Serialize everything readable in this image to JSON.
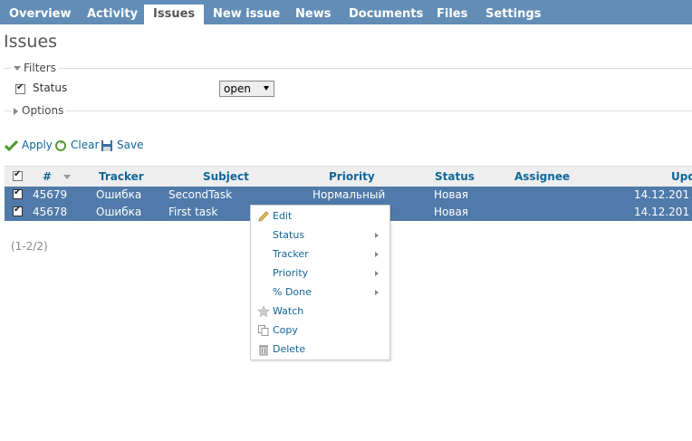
{
  "nav": {
    "tabs": [
      {
        "label": "Overview"
      },
      {
        "label": "Activity"
      },
      {
        "label": "Issues"
      },
      {
        "label": "New issue"
      },
      {
        "label": "News"
      },
      {
        "label": "Documents"
      },
      {
        "label": "Files"
      },
      {
        "label": "Settings"
      }
    ],
    "selected": "Issues"
  },
  "page_title": "Issues",
  "filters": {
    "legend": "Filters",
    "status_label": "Status",
    "status_value": "open",
    "status_checked": true
  },
  "options": {
    "legend": "Options"
  },
  "actions": {
    "apply": "Apply",
    "clear": "Clear",
    "save": "Save"
  },
  "table": {
    "headers": {
      "id": "#",
      "tracker": "Tracker",
      "subject": "Subject",
      "priority": "Priority",
      "status": "Status",
      "assignee": "Assignee",
      "updated": "Upd"
    },
    "rows": [
      {
        "id": "45679",
        "tracker": "Ошибка",
        "subject": "SecondTask",
        "priority": "Нормальный",
        "status": "Новая",
        "assignee": "",
        "updated": "14.12.201"
      },
      {
        "id": "45678",
        "tracker": "Ошибка",
        "subject": "First task",
        "priority": "",
        "status": "Новая",
        "assignee": "",
        "updated": "14.12.201"
      }
    ]
  },
  "pagination": "(1-2/2)",
  "context_menu": {
    "items": [
      {
        "label": "Edit",
        "icon": "pencil-icon"
      },
      {
        "label": "Status",
        "submenu": true
      },
      {
        "label": "Tracker",
        "submenu": true
      },
      {
        "label": "Priority",
        "submenu": true
      },
      {
        "label": "% Done",
        "submenu": true
      },
      {
        "label": "Watch",
        "icon": "star-icon"
      },
      {
        "label": "Copy",
        "icon": "copy-icon"
      },
      {
        "label": "Delete",
        "icon": "trash-icon"
      }
    ]
  },
  "colors": {
    "header_bar": "#628db6",
    "selected_row": "#507aaa",
    "link": "#116699"
  }
}
